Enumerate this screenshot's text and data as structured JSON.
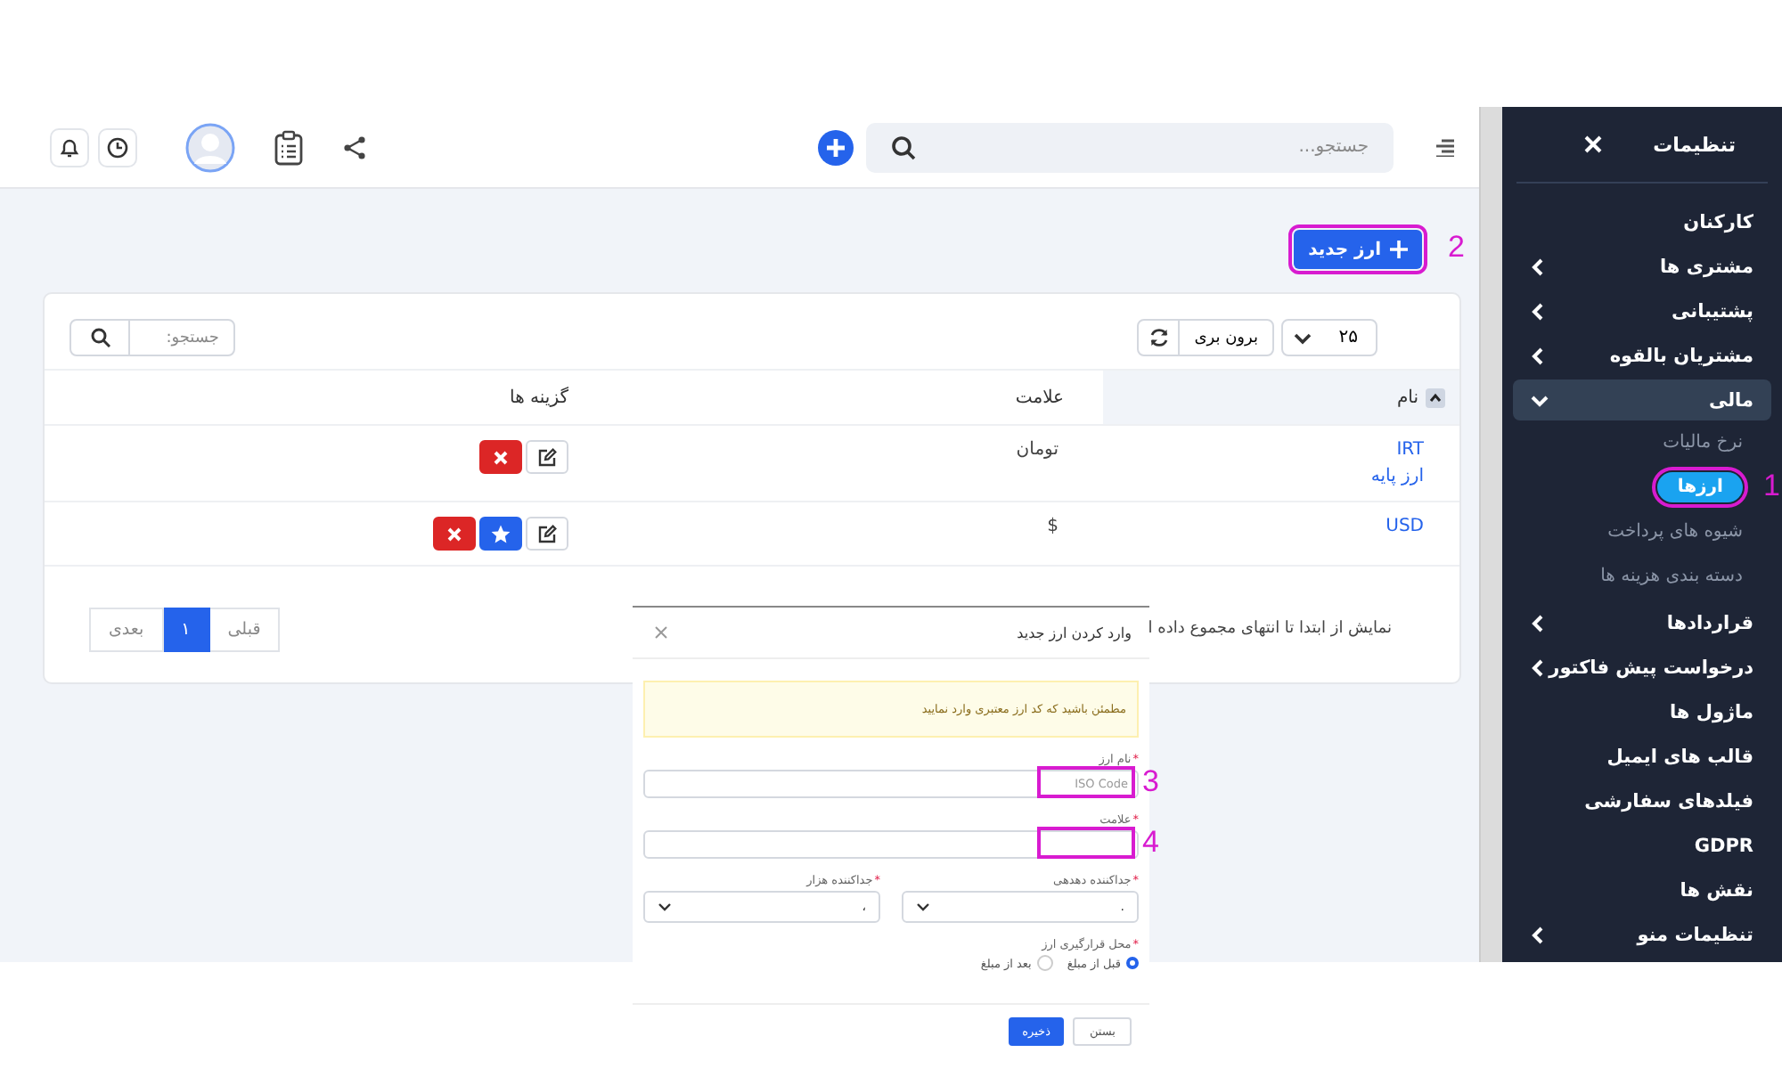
{
  "topbar": {
    "search": {
      "placeholder": "جستجو..."
    }
  },
  "page": {
    "new_button": {
      "label": "ارز جدید",
      "annotation": "2"
    }
  },
  "table_card": {
    "page_size": "۲۵",
    "export_button": "برون بری",
    "search": {
      "placeholder": "جستجو:"
    },
    "columns": [
      {
        "label": "نام",
        "sorted": true
      },
      {
        "label": "علامت",
        "sorted": false
      },
      {
        "label": "گزینه ها",
        "sorted": false
      }
    ],
    "rows": [
      {
        "name": "IRT",
        "note": "ارز پایه",
        "symbol": "تومان",
        "actions": [
          {
            "kind": "edit"
          },
          {
            "kind": "delete"
          }
        ]
      },
      {
        "name": "USD",
        "symbol": "$",
        "actions": [
          {
            "kind": "edit"
          },
          {
            "kind": "star"
          },
          {
            "kind": "delete"
          }
        ]
      }
    ],
    "info": "نمایش از ابتدا تا انتهای مجموع داده ا",
    "pagination": [
      {
        "label": "قبلی",
        "selected": false
      },
      {
        "label": "۱",
        "selected": true
      },
      {
        "label": "بعدی",
        "selected": false
      }
    ]
  },
  "modal": {
    "title": "وارد کردن ارز جدید",
    "alert": "مطمئن باشید که کد ارز معتبری وارد نمایید",
    "fields": [
      {
        "required_mark": "*",
        "label": "نام ارز",
        "placeholder": "ISO Code",
        "annotation": "3"
      },
      {
        "required_mark": "*",
        "label": "علامت",
        "annotation": "4"
      }
    ],
    "selects": [
      {
        "required_mark": "*",
        "label": "جداکننده دهدهی",
        "value": "."
      },
      {
        "required_mark": "*",
        "label": "جداکننده هزار",
        "value": "،"
      }
    ],
    "radio": {
      "required_mark": "*",
      "label": "محل قرارگیری ارز",
      "options": [
        {
          "label": "قبل از مبلغ",
          "selected": true
        },
        {
          "label": "بعد از مبلغ",
          "selected": false
        }
      ]
    },
    "buttons": [
      {
        "kind": "secondary",
        "label": "بستن"
      },
      {
        "kind": "primary",
        "label": "ذخیره"
      }
    ]
  },
  "sidebar": {
    "title": "تنظیمات",
    "items": [
      {
        "kind": "link",
        "label": "کارکنان",
        "selected": false
      },
      {
        "kind": "group",
        "label": "مشتری ها",
        "expanded": false,
        "selected": false
      },
      {
        "kind": "group",
        "label": "پشتیبانی",
        "expanded": false,
        "selected": false
      },
      {
        "kind": "group",
        "label": "مشتریان بالقوه",
        "expanded": false,
        "selected": false
      },
      {
        "kind": "group",
        "label": "مالی",
        "expanded": true,
        "selected": false,
        "children": [
          {
            "label": "نرخ مالیات",
            "selected": false
          },
          {
            "label": "ارزها",
            "selected": true,
            "annotation": "1"
          },
          {
            "label": "شیوه های پرداخت",
            "selected": false
          },
          {
            "label": "دسته بندی هزینه ها",
            "selected": false
          }
        ]
      },
      {
        "kind": "group",
        "label": "قراردادها",
        "expanded": false,
        "selected": false
      },
      {
        "kind": "group",
        "label": "درخواست پیش فاکتور",
        "expanded": false,
        "selected": false
      },
      {
        "kind": "link",
        "label": "ماژول ها",
        "selected": false
      },
      {
        "kind": "link",
        "label": "قالب های ایمیل",
        "selected": false
      },
      {
        "kind": "link",
        "label": "فیلدهای سفارشی",
        "selected": false
      },
      {
        "kind": "link",
        "label": "GDPR",
        "selected": false
      },
      {
        "kind": "link",
        "label": "نقش ها",
        "selected": false
      },
      {
        "kind": "group",
        "label": "تنظیمات منو",
        "expanded": false,
        "selected": false
      }
    ]
  }
}
